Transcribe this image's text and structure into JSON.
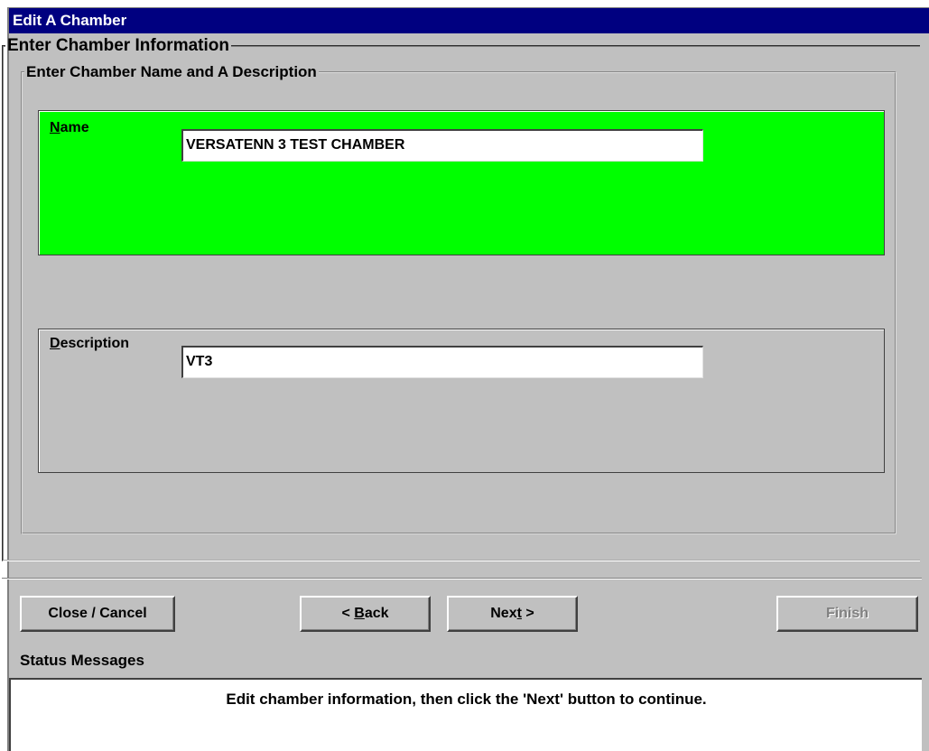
{
  "window": {
    "title": "Edit A Chamber"
  },
  "groups": {
    "outer_legend": "Enter Chamber Information",
    "inner_legend": "Enter Chamber Name and A Description"
  },
  "name_field": {
    "label_key": "N",
    "label_rest": "ame",
    "value": "VERSATENN 3 TEST CHAMBER",
    "panel_color": "#00ff00"
  },
  "description_field": {
    "label_key": "D",
    "label_rest": "escription",
    "value": "VT3"
  },
  "buttons": {
    "close_cancel": "Close / Cancel",
    "back_prefix": "< ",
    "back_key": "B",
    "back_rest": "ack",
    "next_prefix": "Nex",
    "next_key": "t",
    "next_rest": " >",
    "finish": "Finish"
  },
  "status": {
    "label": "Status Messages",
    "message": "Edit chamber information, then click the 'Next' button to continue."
  },
  "colors": {
    "title_bar": "#000080",
    "window_bg": "#c0c0c0"
  }
}
